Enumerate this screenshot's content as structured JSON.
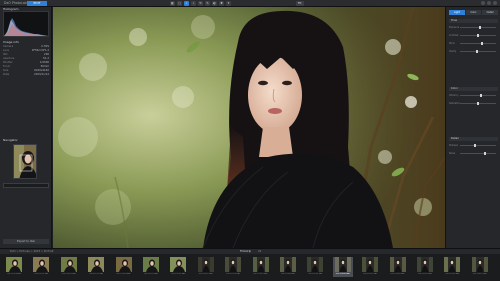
{
  "app": {
    "brand": "DxO PhotoLab",
    "active_tab": "EDIT"
  },
  "toolbar": {
    "icons": [
      "compare-icon",
      "fit-icon",
      "zoom-icon",
      "crop-icon",
      "rotate-icon",
      "brush-icon",
      "mask-icon",
      "picker-icon",
      "repair-icon"
    ],
    "view_label": "Fit"
  },
  "left_panel": {
    "histogram_title": "Histogram",
    "info_title": "Image info",
    "info": [
      {
        "k": "Camera",
        "v": "X-H2S"
      },
      {
        "k": "Lens",
        "v": "XF56mmF1.2"
      },
      {
        "k": "ISO",
        "v": "200"
      },
      {
        "k": "Aperture",
        "v": "f/1.2"
      },
      {
        "k": "Shutter",
        "v": "1/2000"
      },
      {
        "k": "Focal",
        "v": "56mm"
      },
      {
        "k": "Size",
        "v": "6240x4160"
      },
      {
        "k": "Date",
        "v": "2023/11/12"
      }
    ],
    "navigator_title": "Navigator",
    "export_label": "Export to disk"
  },
  "right_panel": {
    "tabs": [
      "Light",
      "Color",
      "Detail"
    ],
    "sections": [
      "Tone",
      "Color",
      "Detail"
    ],
    "sliders": [
      {
        "label": "Exposure",
        "value": 0.55
      },
      {
        "label": "Contrast",
        "value": 0.5
      },
      {
        "label": "Micro",
        "value": 0.62
      },
      {
        "label": "Clarity",
        "value": 0.48
      },
      {
        "label": "Vibrancy",
        "value": 0.6
      },
      {
        "label": "Saturation",
        "value": 0.5
      },
      {
        "label": "Sharpen",
        "value": 0.4
      },
      {
        "label": "Noise",
        "value": 0.7
      }
    ]
  },
  "filmstrip": {
    "path": "DxO > Pictures > 2023 > Portrait",
    "title": "Filmstrip",
    "count": "22",
    "selected_index": 12,
    "thumbs": [
      "DSCF1014.RAF",
      "DSCF1015.RAF",
      "DSCF1016.RAF",
      "DSCF1017.RAF",
      "DSCF1018.RAF",
      "DSCF1019.RAF",
      "DSCF1020.RAF",
      "DSCF1021.RAF",
      "DSCF1022.RAF",
      "DSCF1023.RAF",
      "DSCF1024.RAF",
      "DSCF1025.RAF",
      "DSCF1026.RAF",
      "DSCF1027.RAF",
      "DSCF1028.RAF",
      "DSCF1029.RAF",
      "DSCF1030.RAF",
      "DSCF1031.RAF"
    ]
  },
  "colors": {
    "accent": "#2f80d8",
    "panel": "#25272a",
    "bg": "#1b1c1e"
  }
}
